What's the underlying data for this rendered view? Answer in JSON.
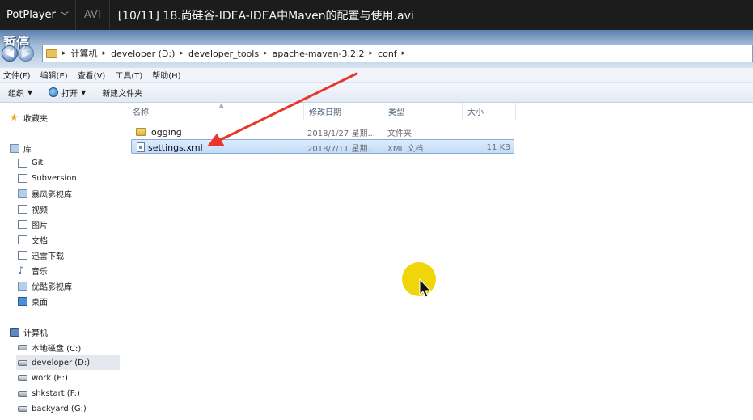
{
  "player": {
    "app_name": "PotPlayer",
    "format": "AVI",
    "title": "[10/11] 18.尚硅谷-IDEA-IDEA中Maven的配置与使用.avi",
    "pause_overlay": "暂停"
  },
  "address": {
    "crumbs": [
      "计算机",
      "developer (D:)",
      "developer_tools",
      "apache-maven-3.2.2",
      "conf"
    ]
  },
  "menu": [
    "文件(F)",
    "编辑(E)",
    "查看(V)",
    "工具(T)",
    "帮助(H)"
  ],
  "toolbar": {
    "organize": "组织",
    "open": "打开",
    "new_folder": "新建文件夹"
  },
  "nav": {
    "favorites": "收藏夹",
    "libraries": "库",
    "library_items": [
      "Git",
      "Subversion",
      "暴风影视库",
      "视频",
      "图片",
      "文档",
      "迅雷下载",
      "音乐",
      "优酷影视库",
      "桌面"
    ],
    "computer": "计算机",
    "drives": [
      "本地磁盘 (C:)",
      "developer (D:)",
      "work (E:)",
      "shkstart (F:)",
      "backyard (G:)"
    ]
  },
  "columns": {
    "name": "名称",
    "date": "修改日期",
    "type": "类型",
    "size": "大小"
  },
  "files": [
    {
      "name": "logging",
      "date": "2018/1/27 星期...",
      "type": "文件夹",
      "size": ""
    },
    {
      "name": "settings.xml",
      "date": "2018/7/11 星期...",
      "type": "XML 文档",
      "size": "11 KB"
    }
  ],
  "colors": {
    "annotation_arrow": "#e8362a",
    "cursor_highlight": "#f0d50a",
    "selection": "#cfe3fa"
  },
  "icons": [
    "back-arrow-icon",
    "forward-arrow-icon",
    "folder-icon",
    "xml-file-icon",
    "star-icon",
    "drive-icon",
    "computer-icon",
    "music-icon",
    "mouse-cursor-icon"
  ]
}
